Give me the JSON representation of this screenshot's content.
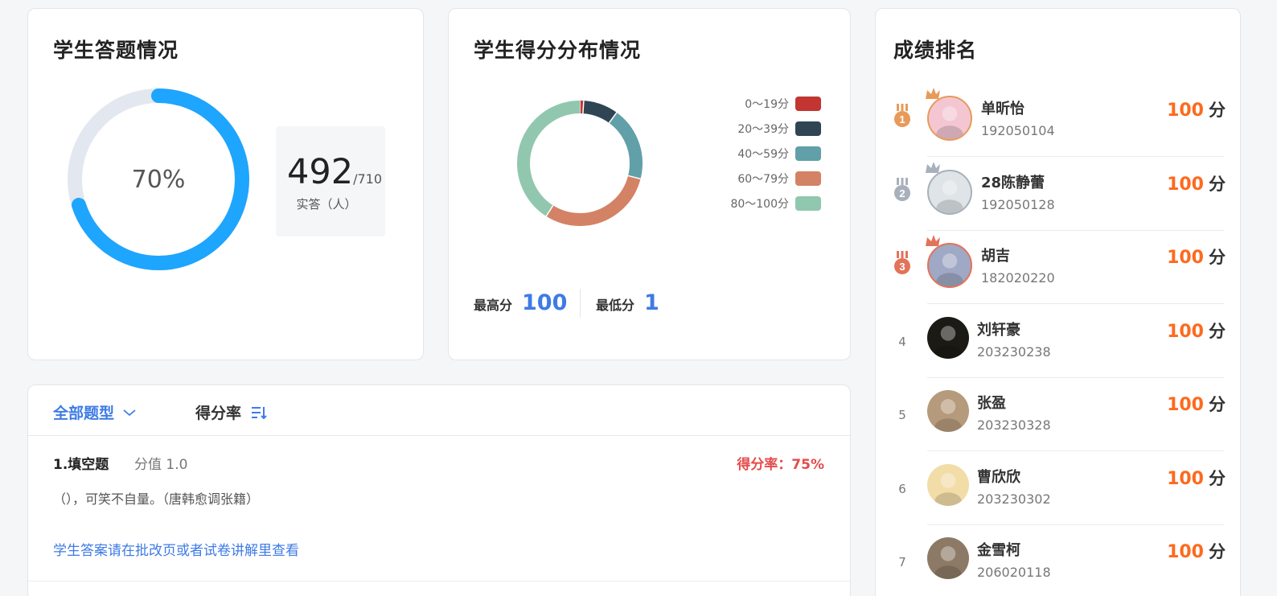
{
  "answer_card": {
    "title": "学生答题情况",
    "percent_text": "70%",
    "percent_value": 0.7,
    "answered": "492",
    "total": "/710",
    "label": "实答（人）"
  },
  "distribution_card": {
    "title": "学生得分分布情况",
    "legend": [
      {
        "label": "0～19分",
        "color": "#c23531"
      },
      {
        "label": "20～39分",
        "color": "#2f4554"
      },
      {
        "label": "40～59分",
        "color": "#61a0a8"
      },
      {
        "label": "60～79分",
        "color": "#d48265"
      },
      {
        "label": "80～100分",
        "color": "#91c7ae"
      }
    ],
    "max_label": "最高分",
    "max_value": "100",
    "min_label": "最低分",
    "min_value": "1"
  },
  "chart_data": {
    "type": "pie",
    "donut": true,
    "categories": [
      "0～19分",
      "20～39分",
      "40～59分",
      "60～79分",
      "80～100分"
    ],
    "values": [
      1,
      9,
      19,
      30,
      41
    ],
    "colors": [
      "#c23531",
      "#2f4554",
      "#61a0a8",
      "#d48265",
      "#91c7ae"
    ],
    "legend": "right"
  },
  "ranking_card": {
    "title": "成绩排名",
    "items": [
      {
        "rank": "1",
        "name": "单昕怡",
        "id": "192050104",
        "score": "100",
        "unit": "分",
        "medal": "gold",
        "avatar": "#f3c6d2"
      },
      {
        "rank": "2",
        "name": "28陈静蕾",
        "id": "192050128",
        "score": "100",
        "unit": "分",
        "medal": "silver",
        "avatar": "#dfe4e8"
      },
      {
        "rank": "3",
        "name": "胡吉",
        "id": "182020220",
        "score": "100",
        "unit": "分",
        "medal": "bronze",
        "avatar": "#9fa8c4"
      },
      {
        "rank": "4",
        "name": "刘轩豪",
        "id": "203230238",
        "score": "100",
        "unit": "分",
        "avatar": "#1c1a14"
      },
      {
        "rank": "5",
        "name": "张盈",
        "id": "203230328",
        "score": "100",
        "unit": "分",
        "avatar": "#b59a7c"
      },
      {
        "rank": "6",
        "name": "曹欣欣",
        "id": "203230302",
        "score": "100",
        "unit": "分",
        "avatar": "#f2dca8"
      },
      {
        "rank": "7",
        "name": "金雪柯",
        "id": "206020118",
        "score": "100",
        "unit": "分",
        "avatar": "#8c7a66"
      }
    ]
  },
  "questions_card": {
    "filter_label": "全部题型",
    "sort_label": "得分率",
    "question_title": "1.填空题",
    "points": "分值 1.0",
    "score_rate": "得分率：75%",
    "text": "（），可笑不自量。（唐韩愈调张籍）",
    "link": "学生答案请在批改页或者试卷讲解里查看"
  },
  "colors": {
    "accent": "#3e7be6",
    "ring": "#1ea5fe",
    "ring_track": "#e3e8f0",
    "score": "#fd6a1e",
    "rate": "#e54b4b"
  }
}
